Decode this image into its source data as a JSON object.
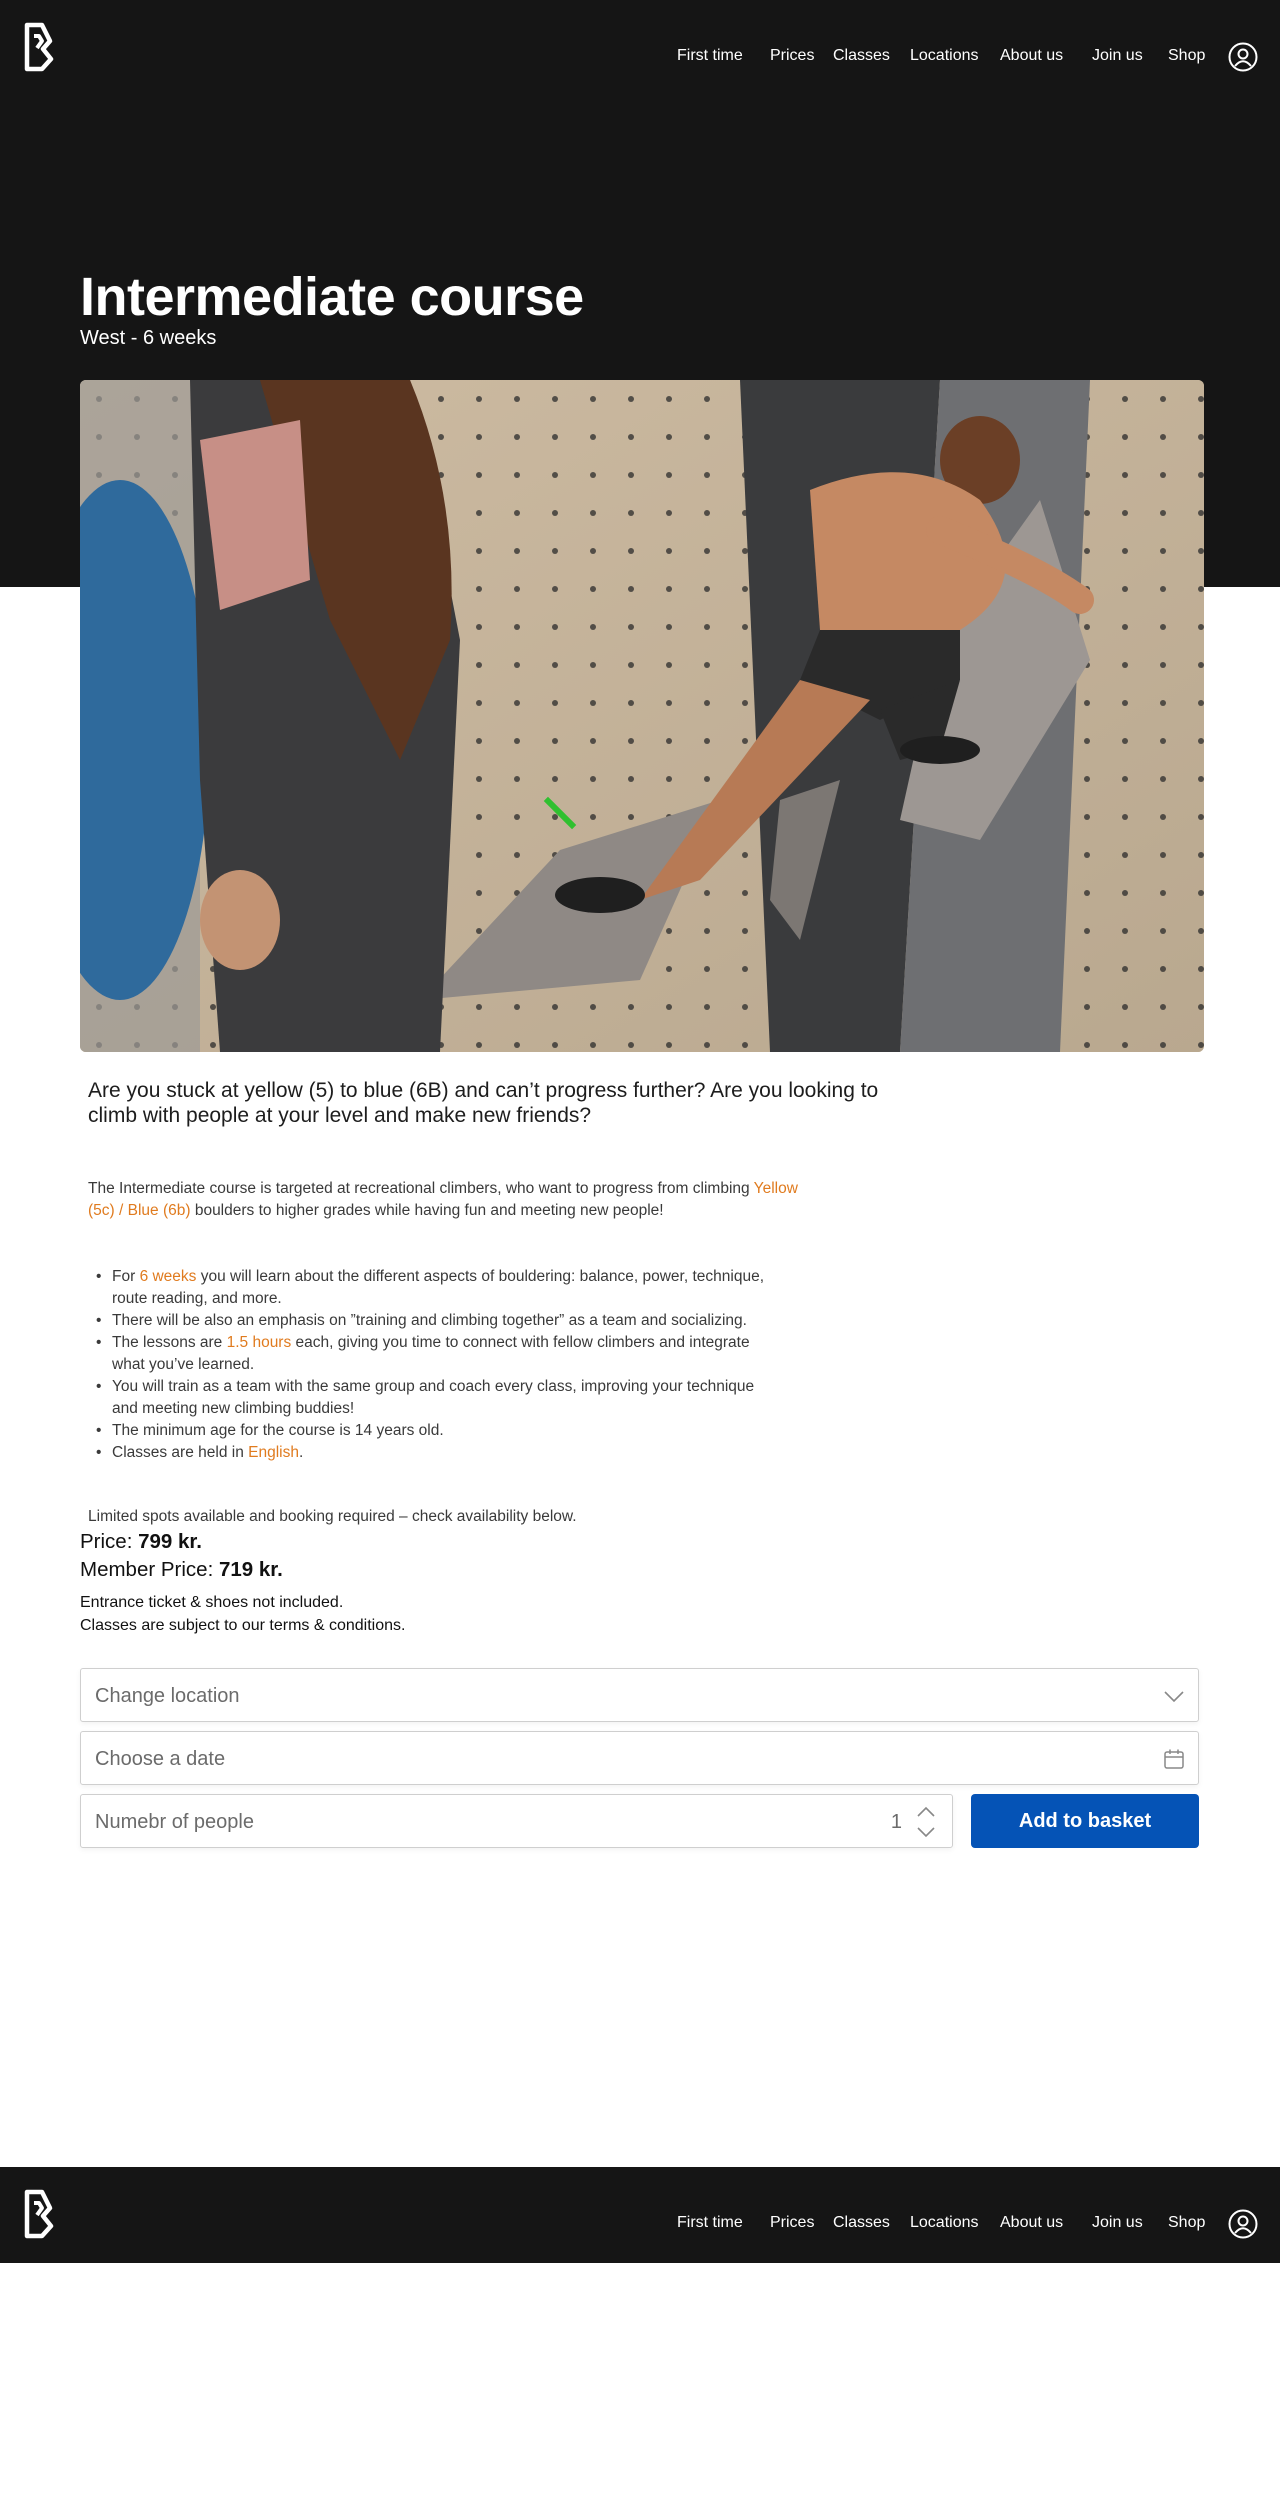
{
  "nav": {
    "links": [
      "First time",
      "Prices",
      "Classes",
      "Locations",
      "About us",
      "Join us",
      "Shop"
    ]
  },
  "course": {
    "title": "Intermediate course",
    "subtitle": "West - 6 weeks"
  },
  "description": {
    "intro": "Are you stuck at yellow (5) to blue (6B) and can’t progress further? Are you looking to climb with people at your level and make new friends?",
    "para_a": "The Intermediate  course is targeted at recreational climbers, who want to progress from climbing ",
    "para_highlight": "Yellow (5c) / Blue (6b)",
    "para_b": "  boulders to higher grades while having fun  and meeting new people!",
    "bullets": [
      {
        "pre": "For ",
        "hl": "6 weeks",
        "post": " you will learn about the different aspects of bouldering: balance, power, technique, route reading, and more."
      },
      {
        "pre": "There will be also an emphasis on ”training and climbing together” as a team and socializing.",
        "hl": "",
        "post": ""
      },
      {
        "pre": "The lessons are ",
        "hl": "1.5 hours",
        "post": " each, giving you time to connect with fellow climbers and integrate what you’ve learned."
      },
      {
        "pre": "You will train as a team with the same group and coach every class, improving your technique and meeting new climbing buddies!",
        "hl": "",
        "post": ""
      },
      {
        "pre": "The minimum age for the course is 14 years old.",
        "hl": "",
        "post": ""
      },
      {
        "pre": "Classes are held in ",
        "hl": "English",
        "post": "."
      }
    ],
    "limited": "Limited spots available and booking required –  check availability below."
  },
  "pricing": {
    "price_label": "Price: ",
    "price_value": "799 kr.",
    "member_label": "Member Price: ",
    "member_value": "719 kr.",
    "note1": "Entrance ticket & shoes not included.",
    "note2": "Classes are subject to our terms & conditions."
  },
  "booking": {
    "location_placeholder": "Change location",
    "date_placeholder": "Choose a date",
    "people_placeholder": "Numebr of people",
    "people_value": "1",
    "basket_label": "Add to basket"
  },
  "colors": {
    "background_dark": "#151515",
    "accent_orange": "#e07b1f",
    "button_blue": "#0553b6"
  },
  "icons": [
    "logo",
    "account-icon",
    "chevron-down-icon",
    "calendar-icon",
    "stepper-icon"
  ]
}
